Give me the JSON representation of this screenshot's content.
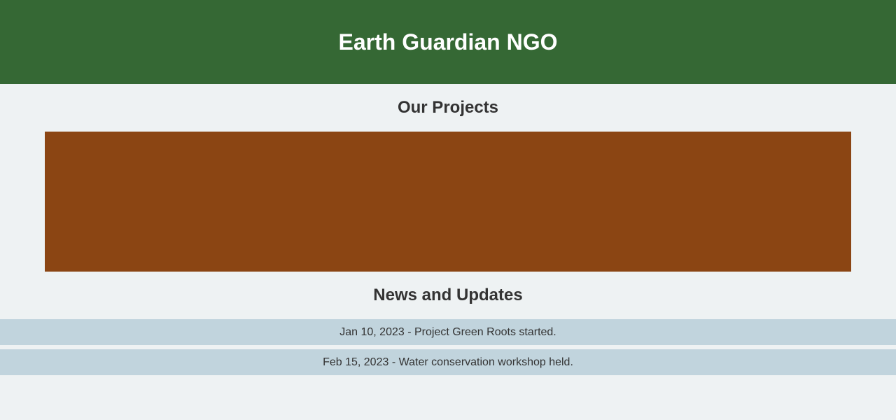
{
  "header": {
    "title": "Earth Guardian NGO"
  },
  "projects": {
    "heading": "Our Projects"
  },
  "news": {
    "heading": "News and Updates",
    "items": [
      "Jan 10, 2023 - Project Green Roots started.",
      "Feb 15, 2023 - Water conservation workshop held."
    ]
  },
  "colors": {
    "header_bg": "#356834",
    "page_bg": "#eef2f3",
    "banner_bg": "#8b4513",
    "news_item_bg": "#c1d4dd"
  }
}
